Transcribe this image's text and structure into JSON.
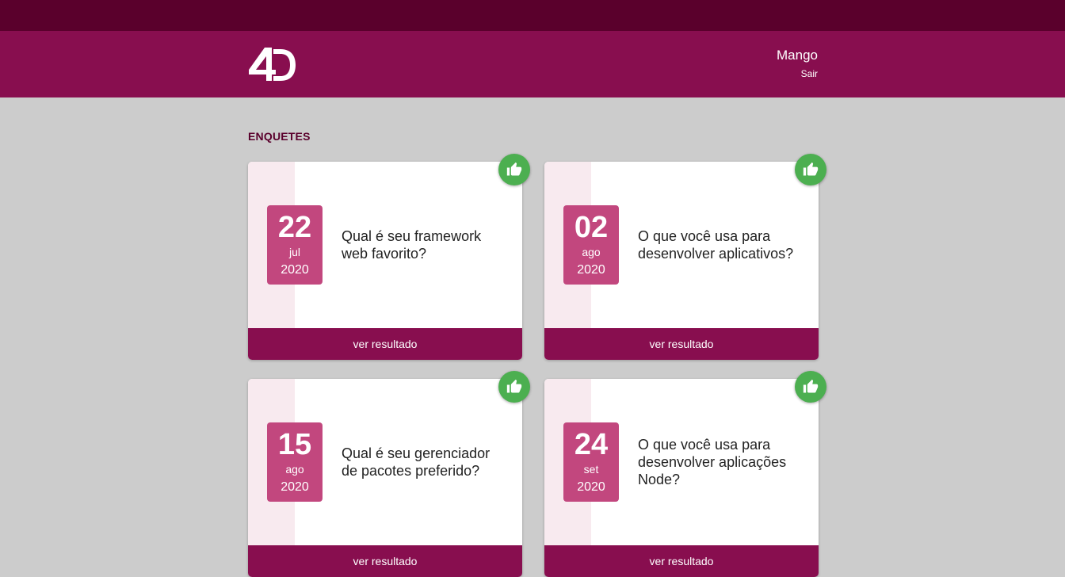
{
  "app": {
    "logo_text": "4D"
  },
  "user": {
    "name": "Mango",
    "logout_label": "Sair"
  },
  "page": {
    "title": "ENQUETES"
  },
  "surveys": [
    {
      "day": "22",
      "month": "jul",
      "year": "2020",
      "question": "Qual é seu framework web favorito?",
      "action_label": "ver resultado",
      "icon": "thumbs-up-icon"
    },
    {
      "day": "02",
      "month": "ago",
      "year": "2020",
      "question": "O que você usa para desenvolver aplicativos?",
      "action_label": "ver resultado",
      "icon": "thumbs-up-icon"
    },
    {
      "day": "15",
      "month": "ago",
      "year": "2020",
      "question": "Qual é seu gerenciador de pacotes preferido?",
      "action_label": "ver resultado",
      "icon": "thumbs-up-icon"
    },
    {
      "day": "24",
      "month": "set",
      "year": "2020",
      "question": "O que você usa para desenvolver aplicações Node?",
      "action_label": "ver resultado",
      "icon": "thumbs-up-icon"
    }
  ],
  "colors": {
    "topbar": "#5a002c",
    "header": "#880e4f",
    "date_badge": "#c2477e",
    "like": "#4caf50",
    "background": "#cccccc"
  }
}
